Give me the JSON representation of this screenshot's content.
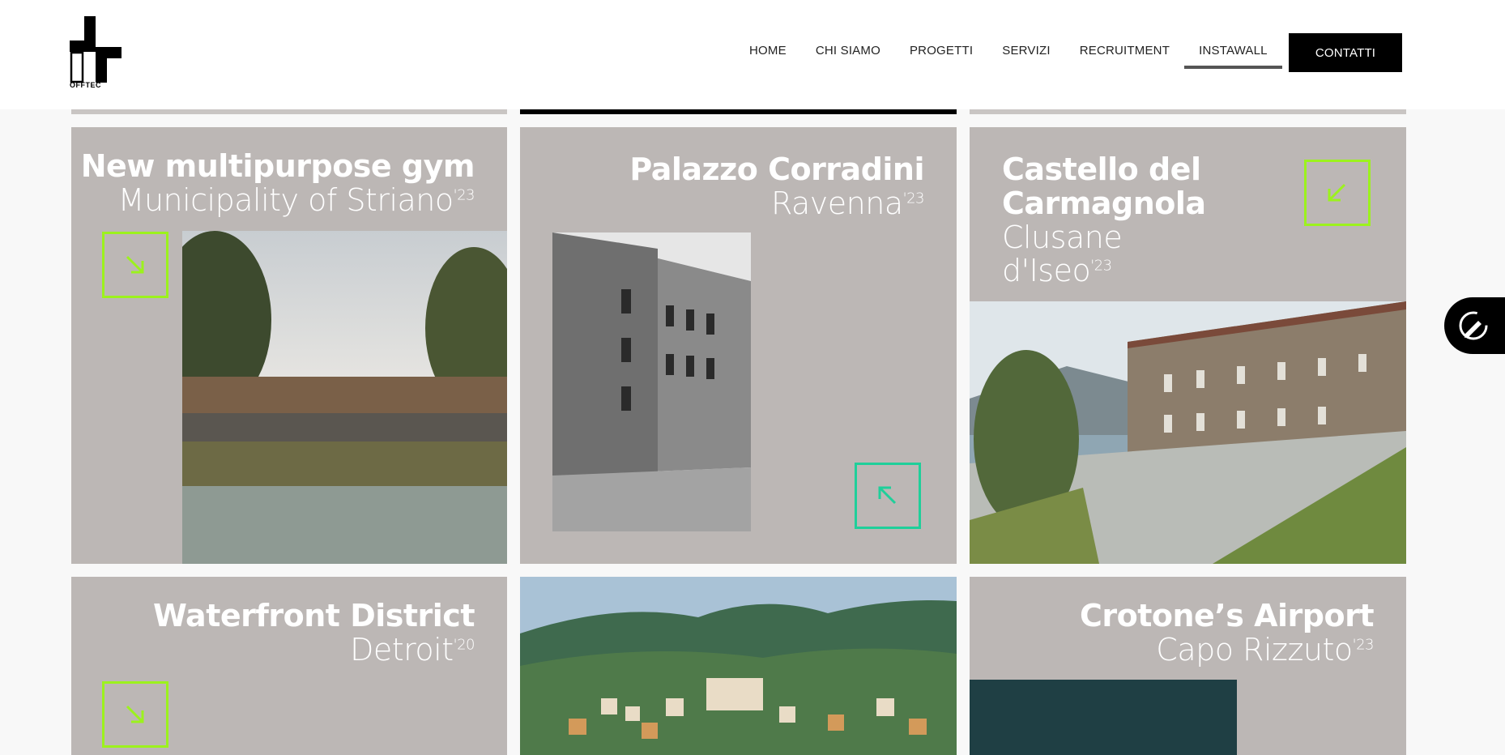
{
  "brand": {
    "logo_text": "OFFTEC"
  },
  "nav": {
    "items": [
      {
        "label": "HOME"
      },
      {
        "label": "CHI SIAMO"
      },
      {
        "label": "PROGETTI"
      },
      {
        "label": "SERVIZI"
      },
      {
        "label": "RECRUITMENT"
      },
      {
        "label": "INSTAWALL"
      }
    ],
    "active": "INSTAWALL",
    "contact_label": "CONTATTI"
  },
  "projects": [
    {
      "title": "New multipurpose gym",
      "location": "Municipality of Striano",
      "year": "'23",
      "arrow": "arrow-down-right"
    },
    {
      "title": "Palazzo Corradini",
      "location": "Ravenna",
      "year": "'23",
      "arrow": "arrow-up-left"
    },
    {
      "title_line1": "Castello del",
      "title_line2": "Carmagnola",
      "location_line1": "Clusane",
      "location_line2": "d'Iseo",
      "year": "'23",
      "arrow": "arrow-down-left"
    },
    {
      "title": "Waterfront District",
      "location": "Detroit",
      "year": "'20",
      "arrow": "arrow-down-right"
    },
    {
      "title": "Crotone’s Airport",
      "location": "Capo Rizzuto",
      "year": "'23"
    }
  ],
  "colors": {
    "card_bg": "#bcb7b5",
    "accent_green": "#9cf21d",
    "accent_teal": "#1fcf9a"
  }
}
